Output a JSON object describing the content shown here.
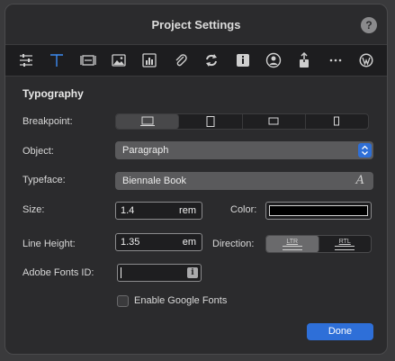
{
  "window": {
    "title": "Project Settings",
    "help_label": "?"
  },
  "toolbar": {
    "icons": [
      "sliders-icon",
      "typography-icon",
      "layout-icon",
      "image-icon",
      "chart-icon",
      "paperclip-icon",
      "sync-icon",
      "info-icon",
      "user-icon",
      "share-icon",
      "more-icon",
      "wordpress-icon"
    ],
    "active_icon": "typography-icon",
    "accent": "#3d8bf2"
  },
  "section": {
    "title": "Typography"
  },
  "breakpoint": {
    "label": "Breakpoint:",
    "options": [
      "desktop",
      "tablet-landscape",
      "tablet-portrait",
      "phone"
    ],
    "selected": "desktop"
  },
  "object": {
    "label": "Object:",
    "value": "Paragraph"
  },
  "typeface": {
    "label": "Typeface:",
    "value": "Biennale Book",
    "icon_glyph": "A"
  },
  "size": {
    "label": "Size:",
    "value": "1.4",
    "unit": "rem"
  },
  "color": {
    "label": "Color:",
    "value": "#000000"
  },
  "line_height": {
    "label": "Line Height:",
    "value": "1.35",
    "unit": "em"
  },
  "direction": {
    "label": "Direction:",
    "options": [
      "LTR",
      "RTL"
    ],
    "selected": "LTR"
  },
  "adobe_fonts": {
    "label": "Adobe Fonts ID:",
    "value": "",
    "info_glyph": "i"
  },
  "google_fonts": {
    "label": "Enable Google Fonts",
    "checked": false
  },
  "done": {
    "label": "Done"
  },
  "colors": {
    "primary_button": "#2e6fd8",
    "dialog_bg": "#2b2b2d"
  }
}
